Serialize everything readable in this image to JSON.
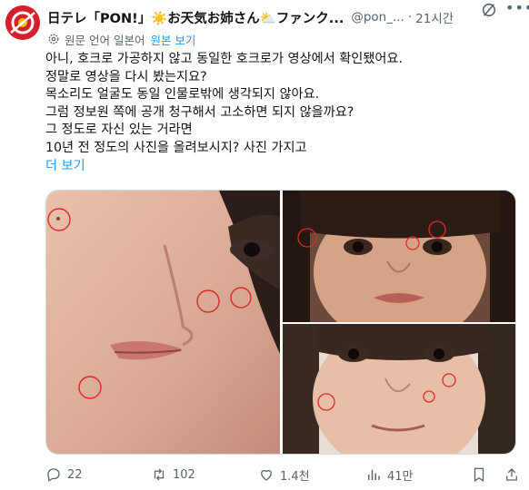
{
  "tweet": {
    "display_name": "日テレ「PON!」☀️お天気お姉さん⛅ファンク...",
    "handle": "@pon_...",
    "separator": "·",
    "time": "21시간",
    "translate_note": "원문 언어 일본어",
    "show_original": "원본 보기",
    "lines": [
      "아니, 호크로 가공하지 않고 동일한 호크로가 영상에서 확인됐어요.",
      "정말로 영상을 다시 봤는지요?",
      "목소리도 얼굴도 동일 인물로밖에 생각되지 않아요.",
      "그럼 정보원 쪽에 공개 청구해서 고소하면 되지 않을까요?",
      "그 정도로 자신 있는 거라면",
      "10년 전 정도의 사진을 올려보시지? 사진 가지고"
    ],
    "show_more": "더 보기"
  },
  "media": {
    "images": [
      {
        "name": "photo-closeup-face"
      },
      {
        "name": "photo-face-bangs"
      },
      {
        "name": "photo-face-smiling"
      }
    ]
  },
  "actions": {
    "replies": "22",
    "retweets": "102",
    "likes": "1.4천",
    "views": "41만"
  },
  "icons": {
    "reply": "reply-icon",
    "retweet": "retweet-icon",
    "like": "heart-icon",
    "views": "views-chart-icon",
    "bookmark": "bookmark-icon",
    "share": "share-icon",
    "grok": "grok-icon",
    "more": "more-icon",
    "translate": "translate-gear-icon"
  },
  "colors": {
    "link": "#1d9bf0",
    "secondary": "#536471",
    "text": "#0f1419",
    "avatar": "#d3202d"
  }
}
